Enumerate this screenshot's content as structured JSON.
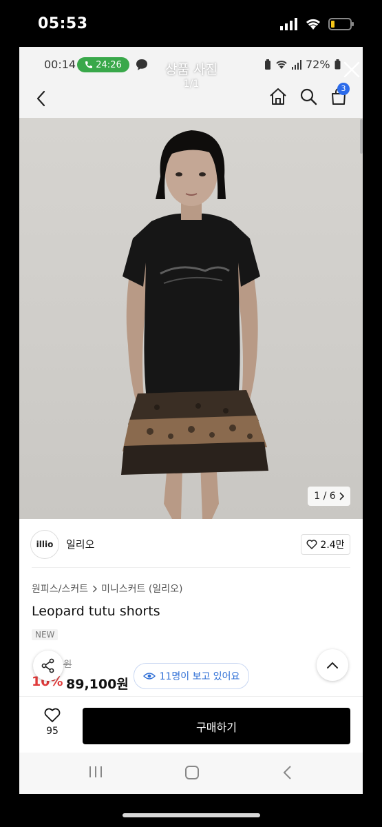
{
  "outer_status": {
    "time": "05:53"
  },
  "viewer": {
    "inner_time": "00:14",
    "call_timer": "24:26",
    "title": "상품 사진",
    "count": "1/1",
    "battery_pct": "72%"
  },
  "header": {
    "cart_count": "3"
  },
  "photo": {
    "counter": "1 / 6"
  },
  "brand": {
    "logo_text": "illio",
    "name": "일리오",
    "likes": "2.4만"
  },
  "breadcrumb": [
    "원피스/스커트",
    "미니스커트 (일리오)"
  ],
  "product": {
    "title": "Leopard tutu shorts",
    "badge": "NEW",
    "orig_price_partial": "0원",
    "discount_partial": "10%",
    "sale_price": "89,100원"
  },
  "viewers_text": "11명이 보고 있어요",
  "action_bar": {
    "wish_count": "95",
    "buy_label": "구매하기"
  },
  "colors": {
    "accent_blue": "#2f6fd6",
    "discount_red": "#e03a3a",
    "call_green": "#39a84a",
    "buy_black": "#000000"
  }
}
